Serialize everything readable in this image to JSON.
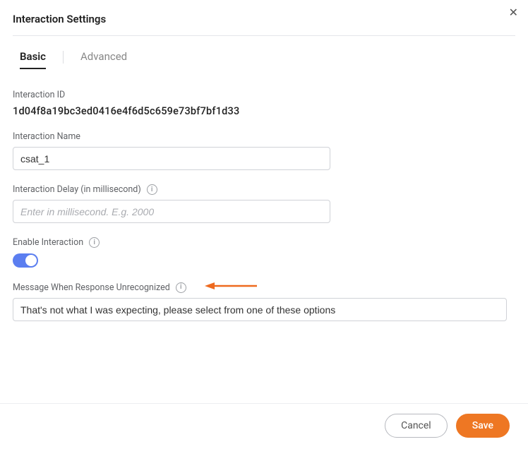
{
  "modal": {
    "title": "Interaction Settings",
    "tabs": {
      "basic": "Basic",
      "advanced": "Advanced"
    }
  },
  "fields": {
    "interactionId": {
      "label": "Interaction ID",
      "value": "1d04f8a19bc3ed0416e4f6d5c659e73bf7bf1d33"
    },
    "interactionName": {
      "label": "Interaction Name",
      "value": "csat_1"
    },
    "interactionDelay": {
      "label": "Interaction Delay (in millisecond)",
      "placeholder": "Enter in millisecond. E.g. 2000",
      "value": ""
    },
    "enableInteraction": {
      "label": "Enable Interaction",
      "value": true
    },
    "unrecognized": {
      "label": "Message When Response Unrecognized",
      "value": "That's not what I was expecting, please select from one of these options"
    }
  },
  "footer": {
    "cancel": "Cancel",
    "save": "Save"
  },
  "icons": {
    "info": "i",
    "close": "✕"
  },
  "colors": {
    "accent": "#ee7723",
    "toggle": "#5b7ef0"
  }
}
